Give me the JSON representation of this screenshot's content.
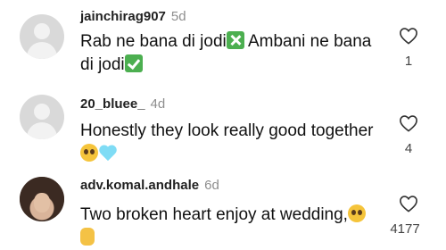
{
  "comments": [
    {
      "username": "jainchirag907",
      "age": "5d",
      "text_parts": [
        "Rab ne bana di jodi",
        "Ambani ne bana di jodi"
      ],
      "emojis": [
        "cross-mark-emoji",
        "check-mark-emoji"
      ],
      "likes": "1",
      "avatar": "default"
    },
    {
      "username": "20_bluee_",
      "age": "4d",
      "text": "Honestly they look really good together",
      "emojis": [
        "pleading-face-emoji",
        "light-blue-heart-emoji"
      ],
      "likes": "4",
      "avatar": "default"
    },
    {
      "username": "adv.komal.andhale",
      "age": "6d",
      "text": "Two broken heart enjoy at wedding,",
      "emojis": [
        "pleading-face-emoji",
        "crossed-fingers-emoji"
      ],
      "likes": "4177",
      "avatar": "photo"
    }
  ],
  "colors": {
    "secondary_text": "#8e8e8e",
    "avatar_placeholder": "#d9d9d9",
    "emoji_green": "#4caf50"
  },
  "icons": {
    "like": "heart-outline-icon"
  }
}
